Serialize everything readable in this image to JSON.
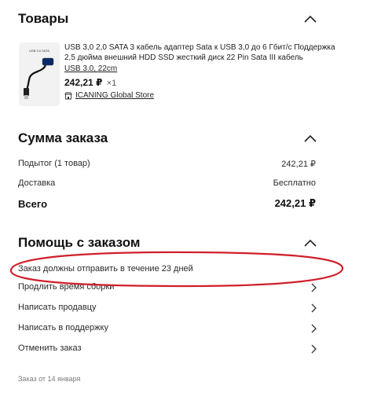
{
  "sections": {
    "goods_title": "Товары",
    "summary_title": "Сумма заказа",
    "help_title": "Помощь с заказом"
  },
  "product": {
    "thumb_text": "USB 3.0 SATA",
    "title": "USB 3,0 2,0 SATA 3 кабель адаптер Sata к USB 3,0 до 6 Гбит/с Поддержка 2,5 дюйма внешний HDD SSD жесткий диск 22 Pin Sata III кабель",
    "variant": "USB 3.0, 22cm",
    "price": "242,21 ₽",
    "quantity": "×1",
    "store_name": "ICANING Global Store"
  },
  "summary": {
    "subtotal_label": "Подытог (1 товар)",
    "subtotal_value": "242,21 ₽",
    "delivery_label": "Доставка",
    "delivery_value": "Бесплатно",
    "total_label": "Всего",
    "total_value": "242,21 ₽"
  },
  "help": {
    "shipping_notice": "Заказ должны отправить в течение 23 дней",
    "items": [
      {
        "label": "Продлить время сборки"
      },
      {
        "label": "Написать продавцу"
      },
      {
        "label": "Написать в поддержку"
      },
      {
        "label": "Отменить заказ"
      }
    ]
  },
  "footer": {
    "order_date": "Заказ от 14 января"
  },
  "colors": {
    "annotation_ellipse": "#d01f2a",
    "text": "#1f1f1f",
    "muted": "#7a7a7a"
  },
  "icons": {
    "collapse": "chevron-up-icon",
    "row_arrow": "chevron-right-icon",
    "store": "store-icon"
  }
}
